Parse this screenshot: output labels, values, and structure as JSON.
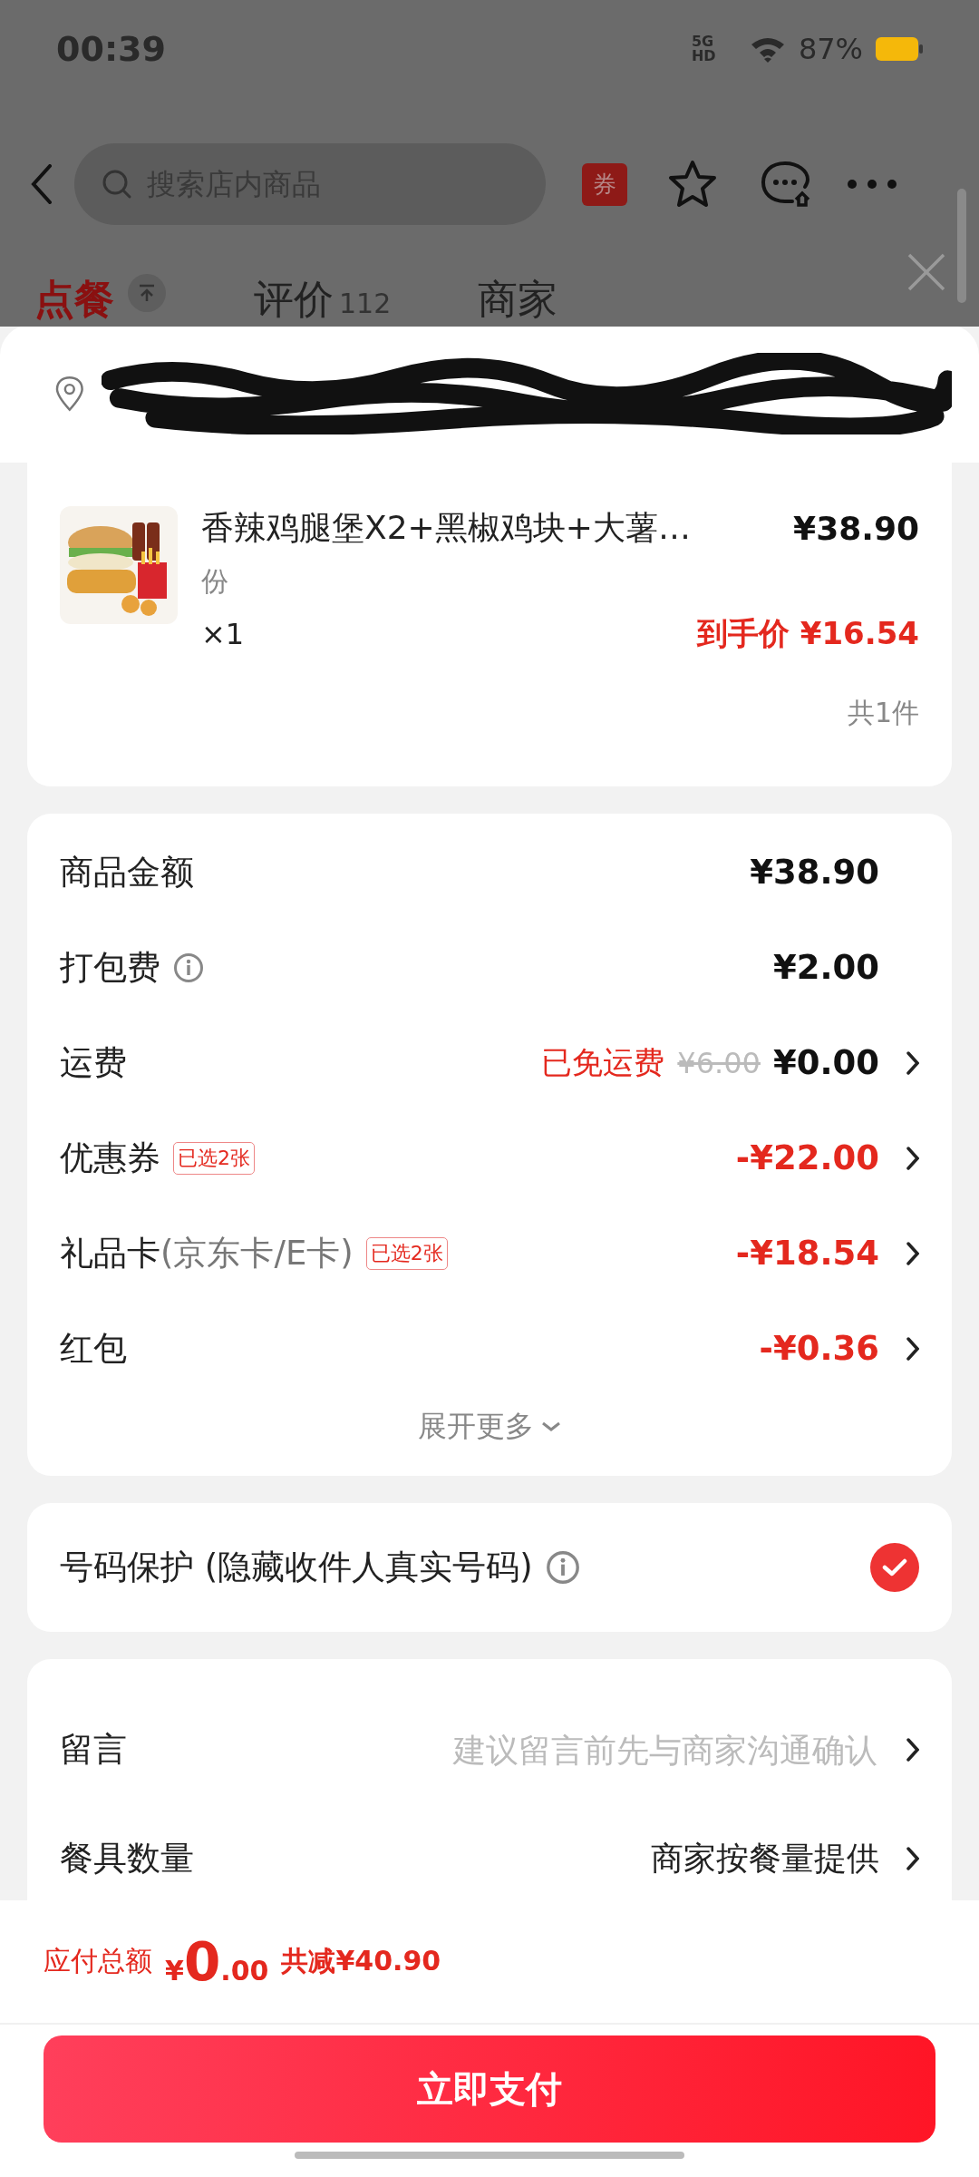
{
  "status_bar": {
    "time": "00:39",
    "network": "5G HD",
    "battery": "87%"
  },
  "header": {
    "search": {
      "placeholder": "搜索店内商品"
    },
    "coupon_badge": "券"
  },
  "tabs": [
    {
      "label": "点餐",
      "selected": true
    },
    {
      "label": "评价",
      "count": "112",
      "selected": false
    },
    {
      "label": "商家",
      "selected": false
    }
  ],
  "order_item": {
    "title": "香辣鸡腿堡X2+黑椒鸡块+大薯…",
    "spec": "份",
    "quantity": "×1",
    "price": "¥38.90",
    "final_price": "到手价 ¥16.54",
    "total_count": "共1件"
  },
  "fees": [
    {
      "label": "商品金额",
      "value": "¥38.90",
      "kind": "plain",
      "info": false,
      "chevron": false
    },
    {
      "label": "打包费",
      "value": "¥2.00",
      "kind": "plain",
      "info": true,
      "chevron": false
    },
    {
      "label": "运费",
      "note": "已免运费",
      "original": "¥6.00",
      "value": "¥0.00",
      "kind": "plain",
      "info": false,
      "chevron": true
    },
    {
      "label": "优惠券",
      "tag": "已选2张",
      "value": "-¥22.00",
      "kind": "discount",
      "info": false,
      "chevron": true
    },
    {
      "label": "礼品卡",
      "label_note": "(京东卡/E卡)",
      "tag": "已选2张",
      "value": "-¥18.54",
      "kind": "discount",
      "info": false,
      "chevron": true
    },
    {
      "label": "红包",
      "value": "-¥0.36",
      "kind": "discount",
      "info": false,
      "chevron": true
    }
  ],
  "expand_more": "展开更多",
  "phone_protection": {
    "label": "号码保护 (隐藏收件人真实号码)",
    "info": true,
    "checked": true
  },
  "extras": [
    {
      "label": "留言",
      "placeholder": "建议留言前先与商家沟通确认"
    },
    {
      "label": "餐具数量",
      "value": "商家按餐量提供"
    }
  ],
  "footer": {
    "total_label": "应付总额",
    "total_amount": "¥0.00",
    "saved": "共减¥40.90",
    "pay_button": "立即支付"
  }
}
